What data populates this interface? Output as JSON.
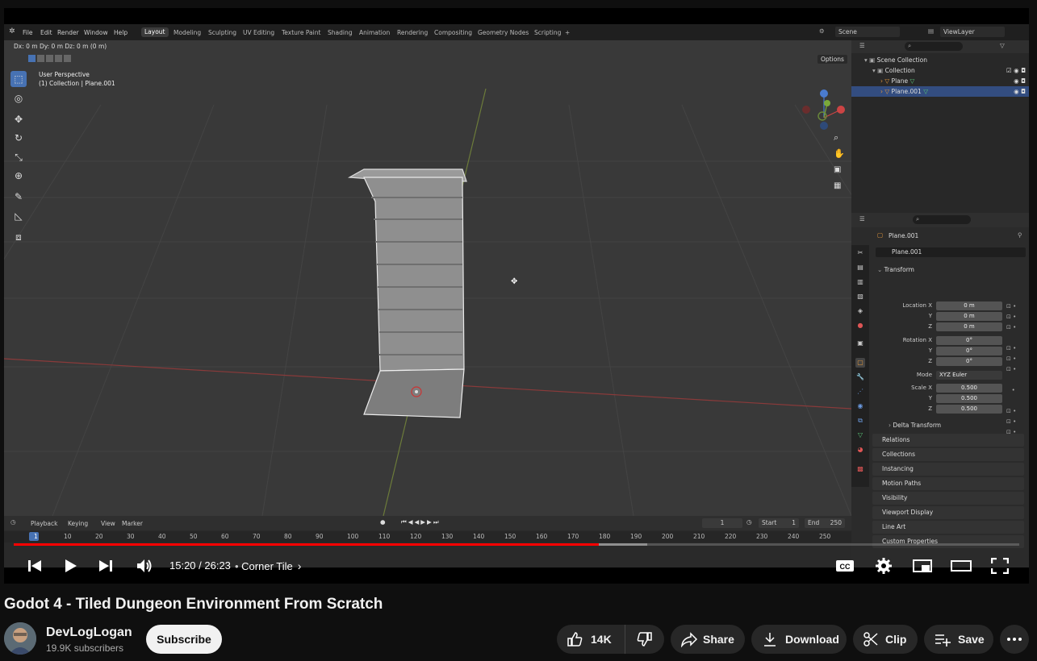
{
  "blender": {
    "menus": [
      "File",
      "Edit",
      "Render",
      "Window",
      "Help"
    ],
    "workspaces": [
      "Layout",
      "Modeling",
      "Sculpting",
      "UV Editing",
      "Texture Paint",
      "Shading",
      "Animation",
      "Rendering",
      "Compositing",
      "Geometry Nodes",
      "Scripting",
      "+"
    ],
    "scene": "Scene",
    "view_layer": "ViewLayer",
    "viewport": {
      "delta": "Dx: 0 m   Dy: 0 m   Dz: 0 m (0 m)",
      "perspective": "User Perspective",
      "collection_info": "(1) Collection | Plane.001",
      "options": "Options"
    },
    "outliner": {
      "items": [
        "Scene Collection",
        "Collection",
        "Plane",
        "Plane.001"
      ]
    },
    "properties": {
      "object_name": "Plane.001",
      "data_name": "Plane.001",
      "transform_label": "Transform",
      "location_label": "Location X",
      "location": [
        "0 m",
        "0 m",
        "0 m"
      ],
      "rotation_label": "Rotation X",
      "rotation": [
        "0°",
        "0°",
        "0°"
      ],
      "mode_label": "Mode",
      "mode": "XYZ Euler",
      "scale_label": "Scale X",
      "scale": [
        "0.500",
        "0.500",
        "0.500"
      ],
      "y": "Y",
      "z": "Z",
      "delta_transform": "Delta Transform",
      "sections": [
        "Relations",
        "Collections",
        "Instancing",
        "Motion Paths",
        "Visibility",
        "Viewport Display",
        "Line Art",
        "Custom Properties"
      ]
    },
    "timeline": {
      "menus": [
        "Playback",
        "Keying",
        "View",
        "Marker"
      ],
      "current_frame": "1",
      "start_label": "Start",
      "start": "1",
      "end_label": "End",
      "end": "250",
      "ticks": [
        "1",
        "10",
        "20",
        "30",
        "40",
        "50",
        "60",
        "70",
        "80",
        "90",
        "100",
        "110",
        "120",
        "130",
        "140",
        "150",
        "160",
        "170",
        "180",
        "190",
        "200",
        "210",
        "220",
        "230",
        "240",
        "250"
      ]
    }
  },
  "player": {
    "time": "15:20 / 26:23",
    "chapter": "Corner Tile",
    "played_fraction": 0.582
  },
  "video": {
    "title": "Godot 4 - Tiled Dungeon Environment From Scratch",
    "channel": "DevLogLogan",
    "subscribers": "19.9K subscribers",
    "subscribe_label": "Subscribe",
    "likes": "14K",
    "share_label": "Share",
    "download_label": "Download",
    "clip_label": "Clip",
    "save_label": "Save"
  }
}
